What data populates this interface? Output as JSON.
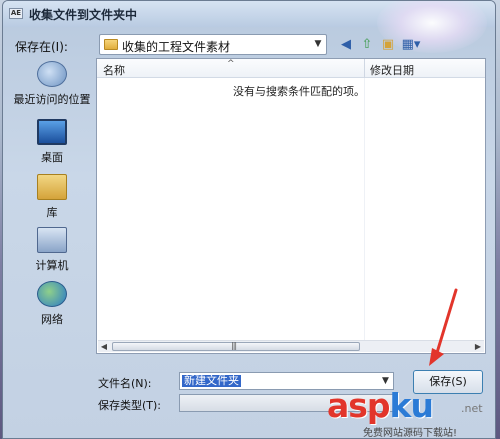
{
  "window": {
    "title": "收集文件到文件夹中",
    "icon_text": "AE"
  },
  "toolbar": {
    "save_in_label": "保存在(I):",
    "path_value": "收集的工程文件素材",
    "icons": [
      "back-icon",
      "up-folder-icon",
      "new-folder-icon",
      "view-menu-icon"
    ]
  },
  "places": [
    {
      "label": "最近访问的位置",
      "icon": "recent-places-icon"
    },
    {
      "label": "桌面",
      "icon": "desktop-icon"
    },
    {
      "label": "库",
      "icon": "libraries-icon"
    },
    {
      "label": "计算机",
      "icon": "computer-icon"
    },
    {
      "label": "网络",
      "icon": "network-icon"
    }
  ],
  "list": {
    "columns": [
      "名称",
      "修改日期"
    ],
    "empty_message": "没有与搜索条件匹配的项。"
  },
  "form": {
    "filename_label": "文件名(N):",
    "filename_value": "新建文件夹",
    "filetype_label": "保存类型(T):",
    "save_label": "保存(S)"
  },
  "watermark": {
    "main_a": "asp",
    "main_b": "ku",
    "net": ".net",
    "sub": "免费网站源码下载站!"
  },
  "colors": {
    "selection": "#3367c9",
    "arrow": "#e2352b",
    "watermark_blue": "#2b7bd6"
  }
}
